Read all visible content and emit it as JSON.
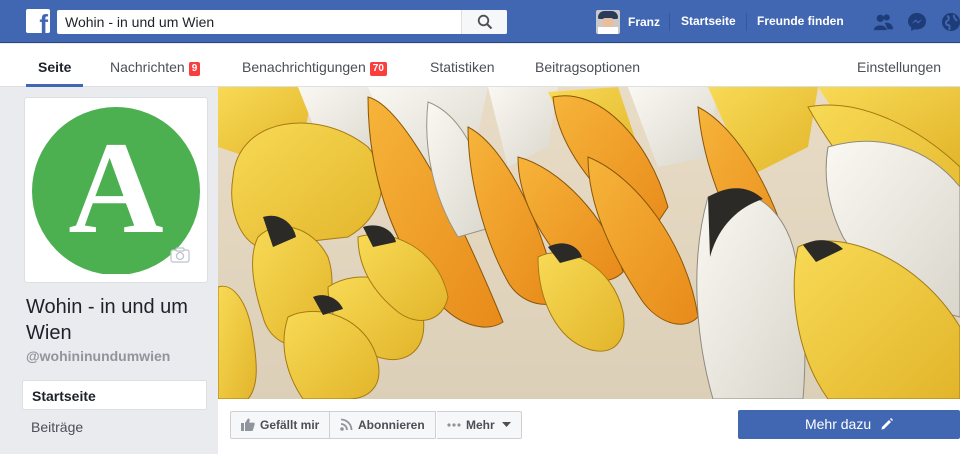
{
  "topbar": {
    "search_value": "Wohin - in und um Wien",
    "user_name": "Franz",
    "home_label": "Startseite",
    "find_friends_label": "Freunde finden"
  },
  "tabs": [
    {
      "label": "Seite"
    },
    {
      "label": "Nachrichten",
      "badge": "9"
    },
    {
      "label": "Benachrichtigungen",
      "badge": "70"
    },
    {
      "label": "Statistiken"
    },
    {
      "label": "Beitragsoptionen"
    },
    {
      "label": "Einstellungen"
    }
  ],
  "page": {
    "logo_letter": "A",
    "title": "Wohin - in und um Wien",
    "handle": "@wohininundumwien"
  },
  "sidebar": {
    "items": [
      {
        "label": "Startseite"
      },
      {
        "label": "Beiträge"
      }
    ]
  },
  "actions": {
    "like_label": "Gefällt mir",
    "follow_label": "Abonnieren",
    "more_label": "Mehr",
    "learn_more_label": "Mehr dazu"
  },
  "colors": {
    "brand_blue": "#4267b2",
    "badge_red": "#fa3e3e",
    "logo_green": "#4caf50"
  }
}
